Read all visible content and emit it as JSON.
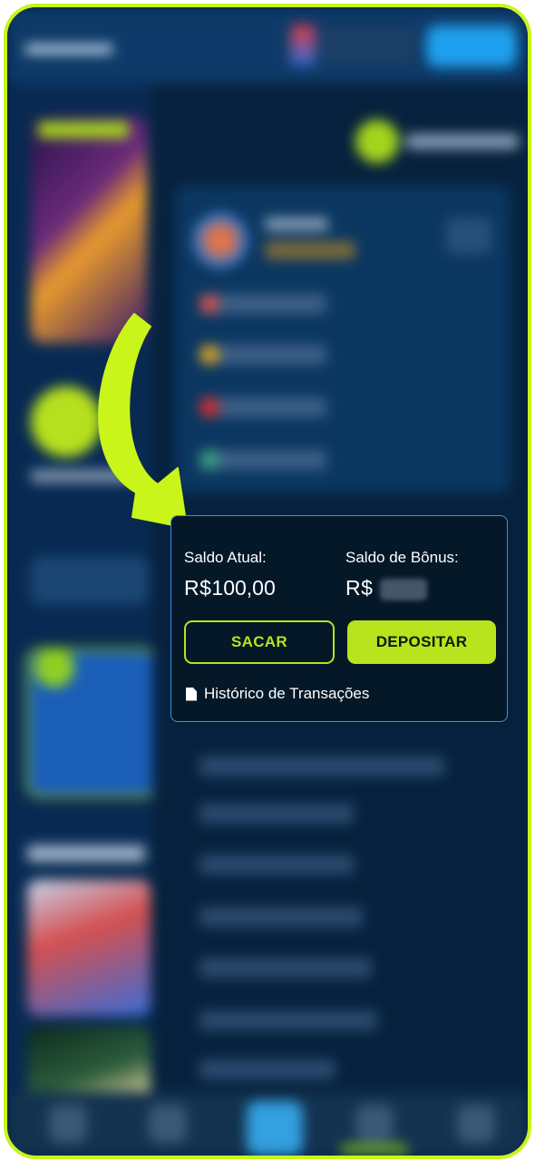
{
  "wallet": {
    "current_balance_label": "Saldo Atual:",
    "current_balance_currency": "R$",
    "current_balance_value": "100,00",
    "bonus_balance_label": "Saldo de Bônus:",
    "bonus_balance_currency": "R$",
    "withdraw_button": "SACAR",
    "deposit_button": "DEPOSITAR",
    "history_link": "Histórico de Transações"
  },
  "colors": {
    "accent": "#b9e31c",
    "card_border": "#3f8fd8",
    "frame": "#c9f51a"
  },
  "icons": {
    "history": "document-icon",
    "pointer": "arrow-pointer"
  }
}
